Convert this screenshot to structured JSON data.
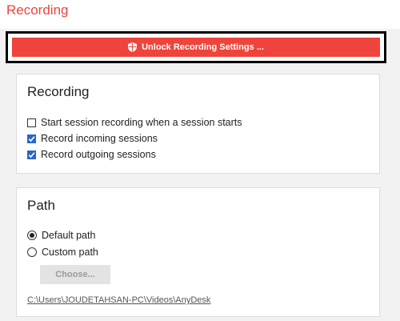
{
  "page": {
    "title": "Recording"
  },
  "unlock": {
    "label": "Unlock Recording Settings ..."
  },
  "recording_panel": {
    "title": "Recording",
    "options": [
      {
        "label": "Start session recording when a session starts",
        "checked": false
      },
      {
        "label": "Record incoming sessions",
        "checked": true
      },
      {
        "label": "Record outgoing sessions",
        "checked": true
      }
    ]
  },
  "path_panel": {
    "title": "Path",
    "options": [
      {
        "label": "Default path",
        "selected": true
      },
      {
        "label": "Custom path",
        "selected": false
      }
    ],
    "choose_label": "Choose...",
    "current_path": "C:\\Users\\JOUDETAHSAN-PC\\Videos\\AnyDesk"
  },
  "colors": {
    "accent": "#ef443b",
    "checkbox": "#2967cc"
  }
}
